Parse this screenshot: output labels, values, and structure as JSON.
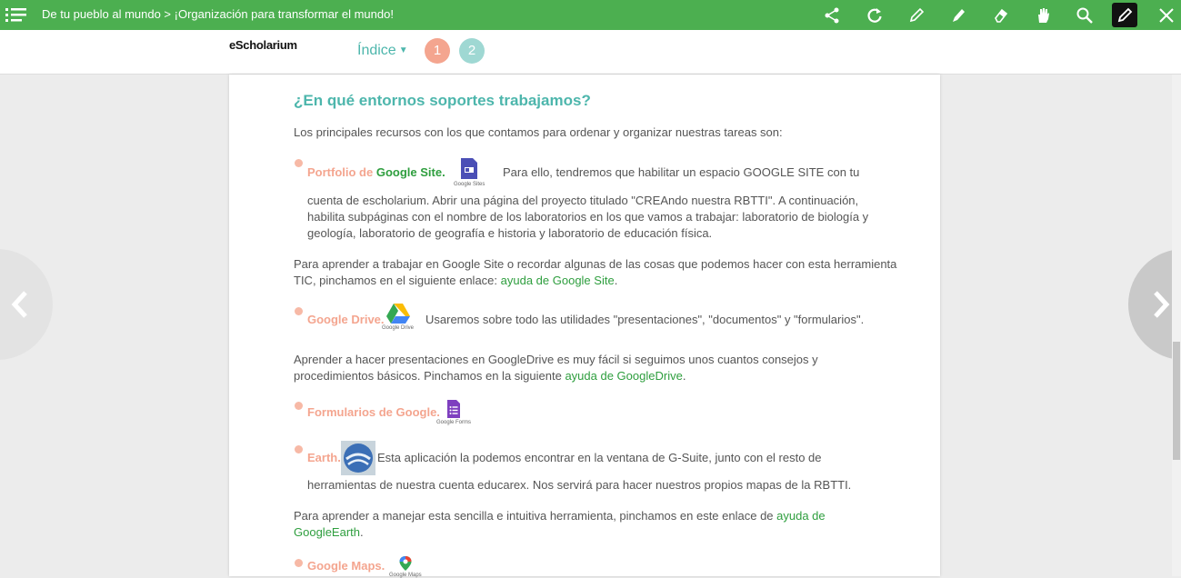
{
  "topbar": {
    "title": "De tu pueblo al mundo > ¡Organización para transformar el mundo!",
    "tools": [
      "share-icon",
      "refresh-icon",
      "pencil-icon",
      "marker-icon",
      "eraser-icon",
      "hand-icon",
      "search-icon",
      "pen-active-icon",
      "close-icon"
    ]
  },
  "header": {
    "brand": "eScholarium",
    "index_label": "Índice",
    "pages": [
      "1",
      "2"
    ],
    "page_colors": [
      "#f4a58f",
      "#9fd8d3"
    ]
  },
  "content": {
    "heading": "¿En qué entornos soportes trabajamos?",
    "intro": "Los principales recursos con los que contamos para ordenar y organizar nuestras tareas son:",
    "site": {
      "label": "Portfolio de ",
      "label_green": "Google Site.",
      "icon_caption": "Google Sites",
      "text1": "Para ello, tendremos que habilitar un espacio GOOGLE SITE con tu",
      "text2": "cuenta de escholarium. Abrir una página del proyecto titulado \"CREAndo nuestra RBTTI\". A continuación,",
      "text3": "habilita subpáginas con el nombre de los laboratorios en los que vamos a trabajar: laboratorio de biología y",
      "text4": "geología, laboratorio de geografía e historia y laboratorio de educación física."
    },
    "site_help": {
      "line1": "Para aprender a trabajar en Google Site o recordar algunas de las cosas que podemos hacer con esta herramienta",
      "line2": "TIC, pinchamos en el siguiente enlace: ",
      "link": "ayuda de Google Site",
      "end": "."
    },
    "drive": {
      "label": "Google Drive.",
      "icon_caption": "Google Drive",
      "text": "Usaremos sobre todo las utilidades \"presentaciones\", \"documentos\" y \"formularios\"."
    },
    "drive_help": {
      "line1": "Aprender a hacer presentaciones en GoogleDrive es muy fácil si seguimos unos cuantos consejos y",
      "line2": "procedimientos básicos. Pinchamos en la siguiente ",
      "link": "ayuda de GoogleDrive",
      "end": "."
    },
    "forms": {
      "label": "Formularios de Google.",
      "icon_caption": "Google Forms"
    },
    "earth": {
      "label": "Earth.",
      "text1": "Esta aplicación la podemos encontrar en la ventana de G-Suite, junto con el resto de",
      "text2": "herramientas de nuestra cuenta educarex. Nos servirá para hacer nuestros propios mapas de la RBTTI."
    },
    "earth_help": {
      "line1": "Para aprender a manejar esta sencilla e intuitiva herramienta, pinchamos en este enlace de ",
      "link1": "ayuda de",
      "link2": "GoogleEarth",
      "end": "."
    },
    "maps": {
      "label": "Google Maps.",
      "icon_caption": "Google Maps"
    }
  },
  "colors": {
    "topbar": "#4caf50",
    "heading": "#4db6ac",
    "bullet_label": "#f4a58f",
    "link": "#2e9e3e"
  }
}
